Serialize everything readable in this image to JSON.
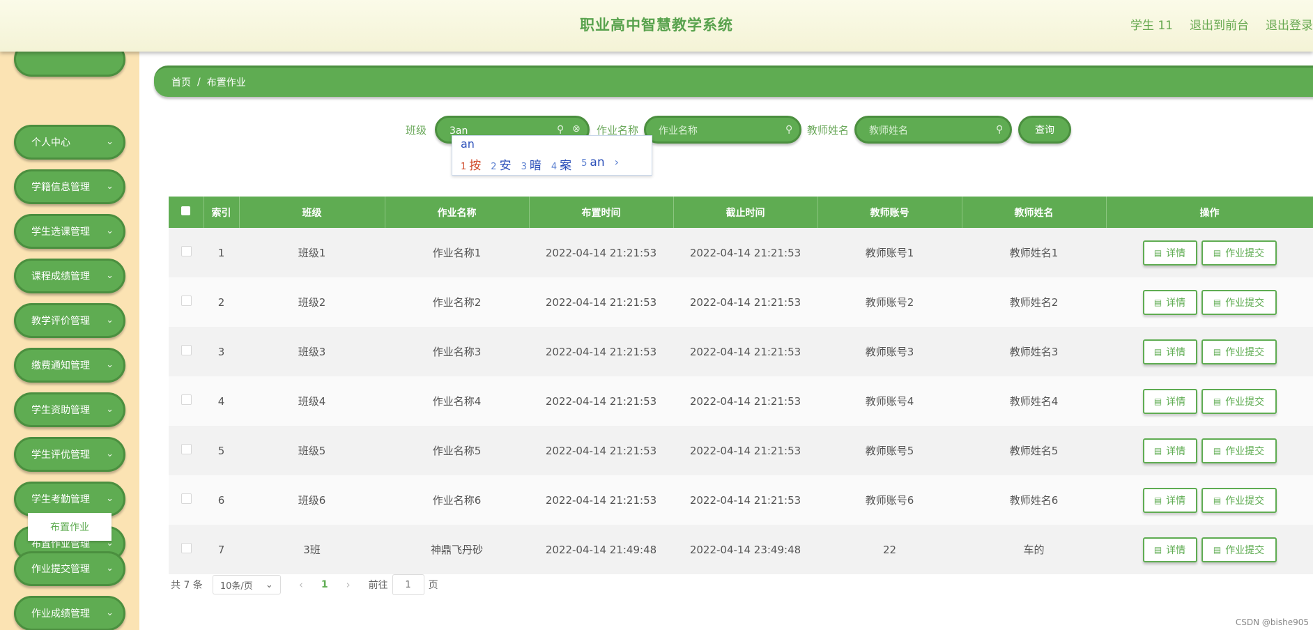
{
  "header": {
    "title": "职业高中智慧教学系统",
    "user": "学生 11",
    "back_front": "退出到前台",
    "logout": "退出登录"
  },
  "sidebar": {
    "items": [
      {
        "label": ""
      },
      {
        "label": "个人中心"
      },
      {
        "label": "学籍信息管理"
      },
      {
        "label": "学生选课管理"
      },
      {
        "label": "课程成绩管理"
      },
      {
        "label": "教学评价管理"
      },
      {
        "label": "缴费通知管理"
      },
      {
        "label": "学生资助管理"
      },
      {
        "label": "学生评优管理"
      },
      {
        "label": "学生考勤管理"
      },
      {
        "label": "布置作业管理"
      },
      {
        "label": "作业提交管理"
      },
      {
        "label": "作业成绩管理"
      }
    ],
    "chevron": "⌄",
    "submenu": "布置作业"
  },
  "breadcrumb": {
    "home": "首页",
    "separator": "/",
    "current": "布置作业"
  },
  "search": {
    "class_label": "班级",
    "class_value": "3an",
    "name_label": "作业名称",
    "name_placeholder": "作业名称",
    "teacher_label": "教师姓名",
    "teacher_placeholder": "教师姓名",
    "query": "查询"
  },
  "ime": {
    "composition": "an",
    "candidates": [
      {
        "num": "1",
        "text": "按"
      },
      {
        "num": "2",
        "text": "安"
      },
      {
        "num": "3",
        "text": "暗"
      },
      {
        "num": "4",
        "text": "案"
      },
      {
        "num": "5",
        "text": "an"
      }
    ],
    "next": "›"
  },
  "table": {
    "headers": [
      "索引",
      "班级",
      "作业名称",
      "布置时间",
      "截止时间",
      "教师账号",
      "教师姓名",
      "操作"
    ],
    "detail_label": "详情",
    "submit_label": "作业提交",
    "rows": [
      [
        "1",
        "班级1",
        "作业名称1",
        "2022-04-14 21:21:53",
        "2022-04-14 21:21:53",
        "教师账号1",
        "教师姓名1"
      ],
      [
        "2",
        "班级2",
        "作业名称2",
        "2022-04-14 21:21:53",
        "2022-04-14 21:21:53",
        "教师账号2",
        "教师姓名2"
      ],
      [
        "3",
        "班级3",
        "作业名称3",
        "2022-04-14 21:21:53",
        "2022-04-14 21:21:53",
        "教师账号3",
        "教师姓名3"
      ],
      [
        "4",
        "班级4",
        "作业名称4",
        "2022-04-14 21:21:53",
        "2022-04-14 21:21:53",
        "教师账号4",
        "教师姓名4"
      ],
      [
        "5",
        "班级5",
        "作业名称5",
        "2022-04-14 21:21:53",
        "2022-04-14 21:21:53",
        "教师账号5",
        "教师姓名5"
      ],
      [
        "6",
        "班级6",
        "作业名称6",
        "2022-04-14 21:21:53",
        "2022-04-14 21:21:53",
        "教师账号6",
        "教师姓名6"
      ],
      [
        "7",
        "3班",
        "神鼎飞丹砂",
        "2022-04-14 21:49:48",
        "2022-04-14 23:49:48",
        "22",
        "车的"
      ]
    ]
  },
  "pagination": {
    "total": "共 7 条",
    "page_size": "10条/页",
    "prev": "‹",
    "current": "1",
    "next": "›",
    "goto": "前往",
    "goto_value": "1",
    "page_unit": "页"
  },
  "watermark": "CSDN @bishe905"
}
